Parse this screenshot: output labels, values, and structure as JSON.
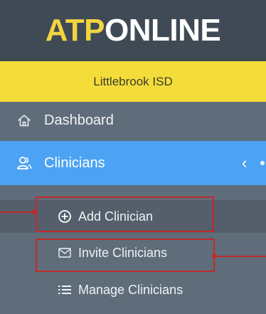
{
  "logo": {
    "part_a": "ATP",
    "part_b": "ONLINE"
  },
  "org": {
    "name": "Littlebrook ISD"
  },
  "nav": {
    "dashboard": {
      "label": "Dashboard",
      "icon": "home-icon"
    },
    "clinicians": {
      "label": "Clinicians",
      "icon": "users-icon",
      "chevron": "‹"
    }
  },
  "submenu": {
    "add": {
      "label": "Add Clinician",
      "icon": "plus-circle-icon"
    },
    "invite": {
      "label": "Invite Clinicians",
      "icon": "envelope-icon"
    },
    "manage": {
      "label": "Manage Clinicians",
      "icon": "list-icon"
    }
  },
  "colors": {
    "logo_bar": "#3f4a55",
    "org_bar": "#f4dd3a",
    "sidebar": "#5f6d7a",
    "active": "#4da3f3",
    "highlight": "#c02a2a"
  }
}
